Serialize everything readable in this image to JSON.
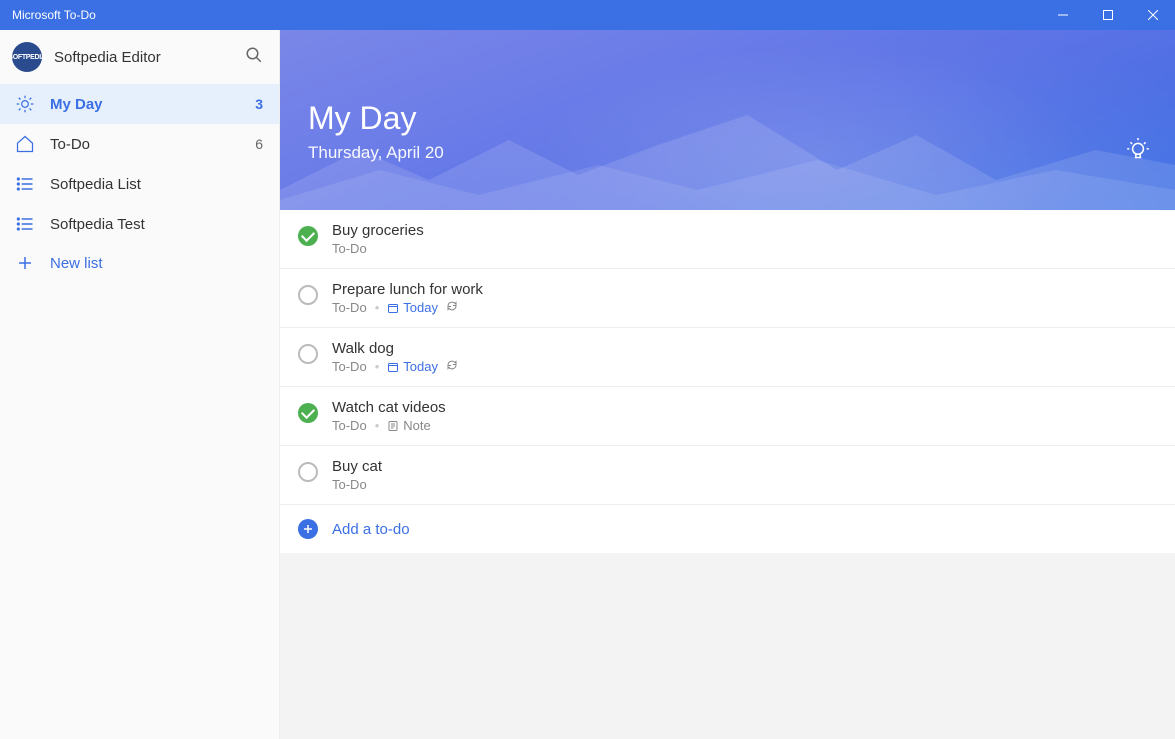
{
  "window": {
    "title": "Microsoft To-Do"
  },
  "user": {
    "name": "Softpedia Editor",
    "avatar_text": "SOFTPEDIA"
  },
  "sidebar": {
    "items": [
      {
        "label": "My Day",
        "count": "3",
        "icon": "sun"
      },
      {
        "label": "To-Do",
        "count": "6",
        "icon": "home"
      },
      {
        "label": "Softpedia List",
        "count": "",
        "icon": "list"
      },
      {
        "label": "Softpedia Test",
        "count": "",
        "icon": "list"
      }
    ],
    "newlist_label": "New list"
  },
  "hero": {
    "title": "My Day",
    "date": "Thursday, April 20"
  },
  "tasks": [
    {
      "title": "Buy groceries",
      "list": "To-Do",
      "done": true
    },
    {
      "title": "Prepare lunch for work",
      "list": "To-Do",
      "done": false,
      "due": "Today",
      "recur": true
    },
    {
      "title": "Walk dog",
      "list": "To-Do",
      "done": false,
      "due": "Today",
      "recur": true
    },
    {
      "title": "Watch cat videos",
      "list": "To-Do",
      "done": true,
      "note": "Note"
    },
    {
      "title": "Buy cat",
      "list": "To-Do",
      "done": false
    }
  ],
  "addrow": {
    "label": "Add a to-do"
  }
}
